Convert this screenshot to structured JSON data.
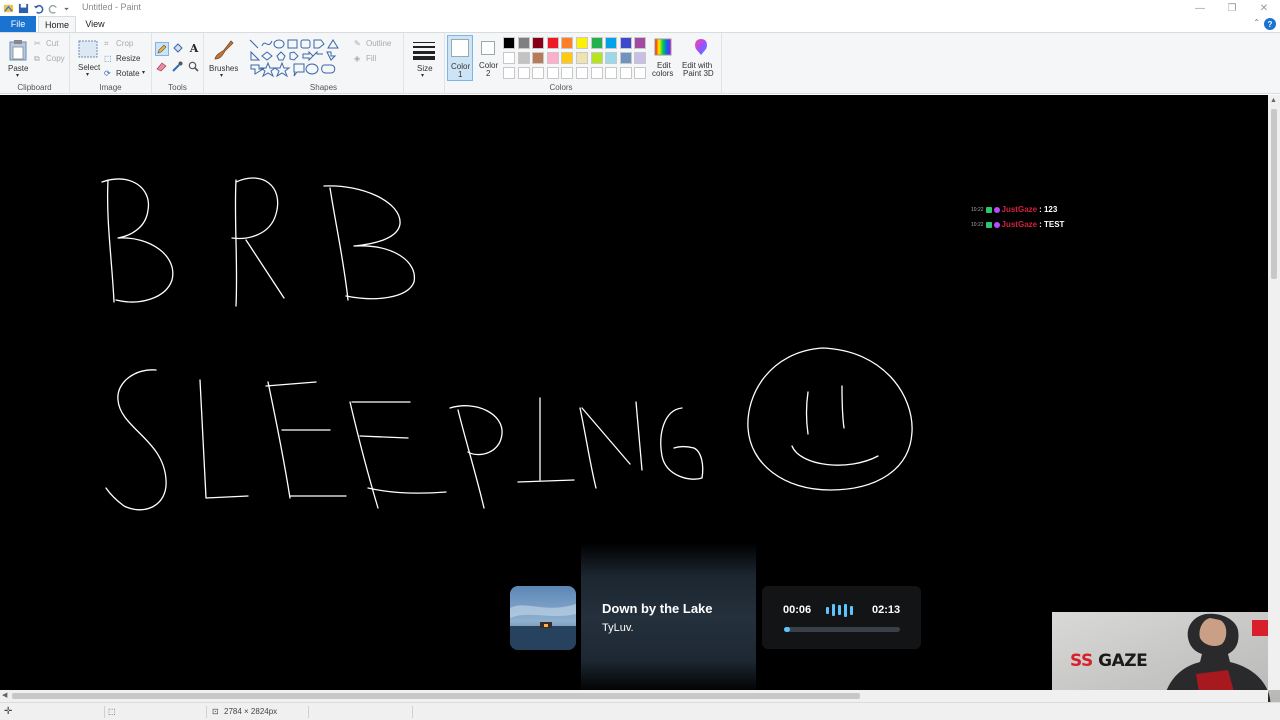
{
  "window": {
    "title": "Untitled - Paint",
    "controls": [
      "—",
      "❐",
      "✕"
    ]
  },
  "menu": {
    "tabs": [
      "File",
      "Home",
      "View"
    ],
    "active_tab": "Home"
  },
  "ribbon": {
    "clipboard": {
      "paste": "Paste",
      "cut": "Cut",
      "copy": "Copy",
      "label": "Clipboard"
    },
    "image": {
      "select": "Select",
      "crop": "Crop",
      "resize": "Resize",
      "rotate": "Rotate",
      "label": "Image"
    },
    "tools": {
      "label": "Tools"
    },
    "brushes": {
      "label": "Brushes"
    },
    "shapes": {
      "outline": "Outline",
      "fill": "Fill",
      "label": "Shapes"
    },
    "size": {
      "label": "Size"
    },
    "colors": {
      "color1_line1": "Color",
      "color1_line2": "1",
      "color2_line1": "Color",
      "color2_line2": "2",
      "edit_line1": "Edit",
      "edit_line2": "colors",
      "paint3d_line1": "Edit with",
      "paint3d_line2": "Paint 3D",
      "label": "Colors",
      "color1_value": "#ffffff",
      "color2_value": "#ffffff",
      "palette_row1": [
        "#000000",
        "#7f7f7f",
        "#880015",
        "#ed1c24",
        "#ff7f27",
        "#fff200",
        "#22b14c",
        "#00a2e8",
        "#3f48cc",
        "#a349a4"
      ],
      "palette_row2": [
        "#ffffff",
        "#c3c3c3",
        "#b97a57",
        "#ffaec9",
        "#ffc90e",
        "#efe4b0",
        "#b5e61d",
        "#99d9ea",
        "#7092be",
        "#c8bfe7"
      ],
      "palette_row3": [
        "#ffffff",
        "#ffffff",
        "#ffffff",
        "#ffffff",
        "#ffffff",
        "#ffffff",
        "#ffffff",
        "#ffffff",
        "#ffffff",
        "#ffffff"
      ]
    }
  },
  "status": {
    "image_size": "2784 × 2824px"
  },
  "chat": [
    {
      "time": "10:22",
      "user": "JustGaze",
      "message": ": 123"
    },
    {
      "time": "10:22",
      "user": "JustGaze",
      "message": ": TEST"
    }
  ],
  "now_playing": {
    "title": "Down by the Lake",
    "artist": "TyLuv.",
    "elapsed": "00:06",
    "duration": "02:13",
    "progress": 0.05
  },
  "webcam": {
    "brand_ss": "SS",
    "brand_name": "GAZE"
  }
}
